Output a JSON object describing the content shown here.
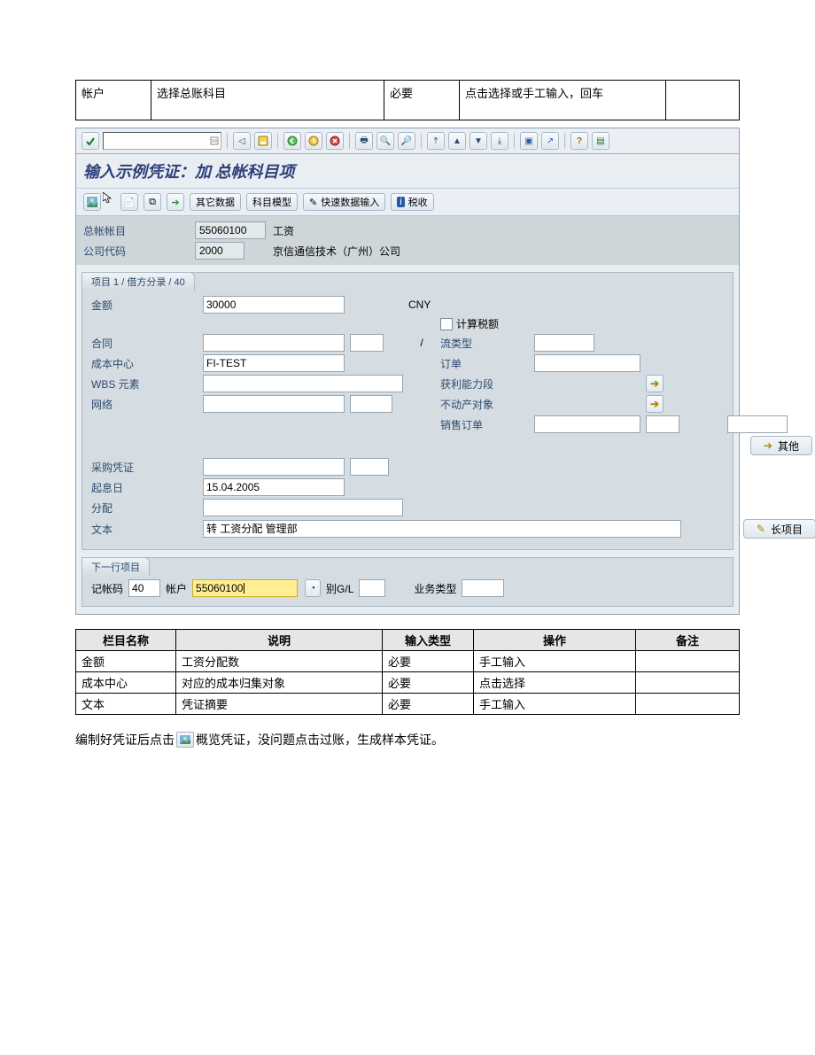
{
  "top_table": {
    "r": [
      {
        "name": "帐户",
        "desc": "选择总账科目",
        "type": "必要",
        "op": "点击选择或手工输入，回车",
        "note": ""
      }
    ]
  },
  "sap": {
    "title": "输入示例凭证：加 总帐科目项",
    "app_toolbar": {
      "other_data": "其它数据",
      "model": "科目模型",
      "fast_entry": "快速数据输入",
      "tax": "税收"
    },
    "header": {
      "gl_account_lbl": "总帐帐目",
      "gl_account": "55060100",
      "gl_account_desc": "工资",
      "company_code_lbl": "公司代码",
      "company_code": "2000",
      "company_code_desc": "京信通信技术（广州）公司"
    },
    "item_tab": "项目 1 / 借方分录 / 40",
    "form": {
      "amount_lbl": "金额",
      "amount": "30000",
      "currency": "CNY",
      "calc_tax_lbl": "计算税额",
      "contract_lbl": "合同",
      "contract": "",
      "slash": "/",
      "flow_type_lbl": "流类型",
      "cost_center_lbl": "成本中心",
      "cost_center": "FI-TEST",
      "order_lbl": "订单",
      "wbs_lbl": "WBS 元素",
      "wbs": "",
      "prof_seg_lbl": "获利能力段",
      "network_lbl": "网络",
      "network": "",
      "real_estate_lbl": "不动产对象",
      "sales_order_lbl": "销售订单",
      "other_btn": "其他",
      "po_lbl": "采购凭证",
      "po": "",
      "value_date_lbl": "起息日",
      "value_date": "15.04.2005",
      "assignment_lbl": "分配",
      "assignment": "",
      "text_lbl": "文本",
      "text": "转 工资分配 管理部",
      "long_item_btn": "长项目"
    },
    "nextline": {
      "tab": "下一行项目",
      "posting_key_lbl": "记帐码",
      "posting_key": "40",
      "account_lbl": "帐户",
      "account": "55060100",
      "sgl_lbl": "别G/L",
      "trans_type_lbl": "业务类型"
    }
  },
  "fields_table": {
    "head": {
      "c1": "栏目名称",
      "c2": "说明",
      "c3": "输入类型",
      "c4": "操作",
      "c5": "备注"
    },
    "rows": [
      {
        "c1": "金额",
        "c2": "工资分配数",
        "c3": "必要",
        "c4": "手工输入",
        "c5": ""
      },
      {
        "c1": "成本中心",
        "c2": "对应的成本归集对象",
        "c3": "必要",
        "c4": "点击选择",
        "c5": ""
      },
      {
        "c1": "文本",
        "c2": "凭证摘要",
        "c3": "必要",
        "c4": "手工输入",
        "c5": ""
      }
    ]
  },
  "footnote": {
    "a": "编制好凭证后点击",
    "b": "概览凭证，没问题点击过账，生成样本凭证。"
  }
}
